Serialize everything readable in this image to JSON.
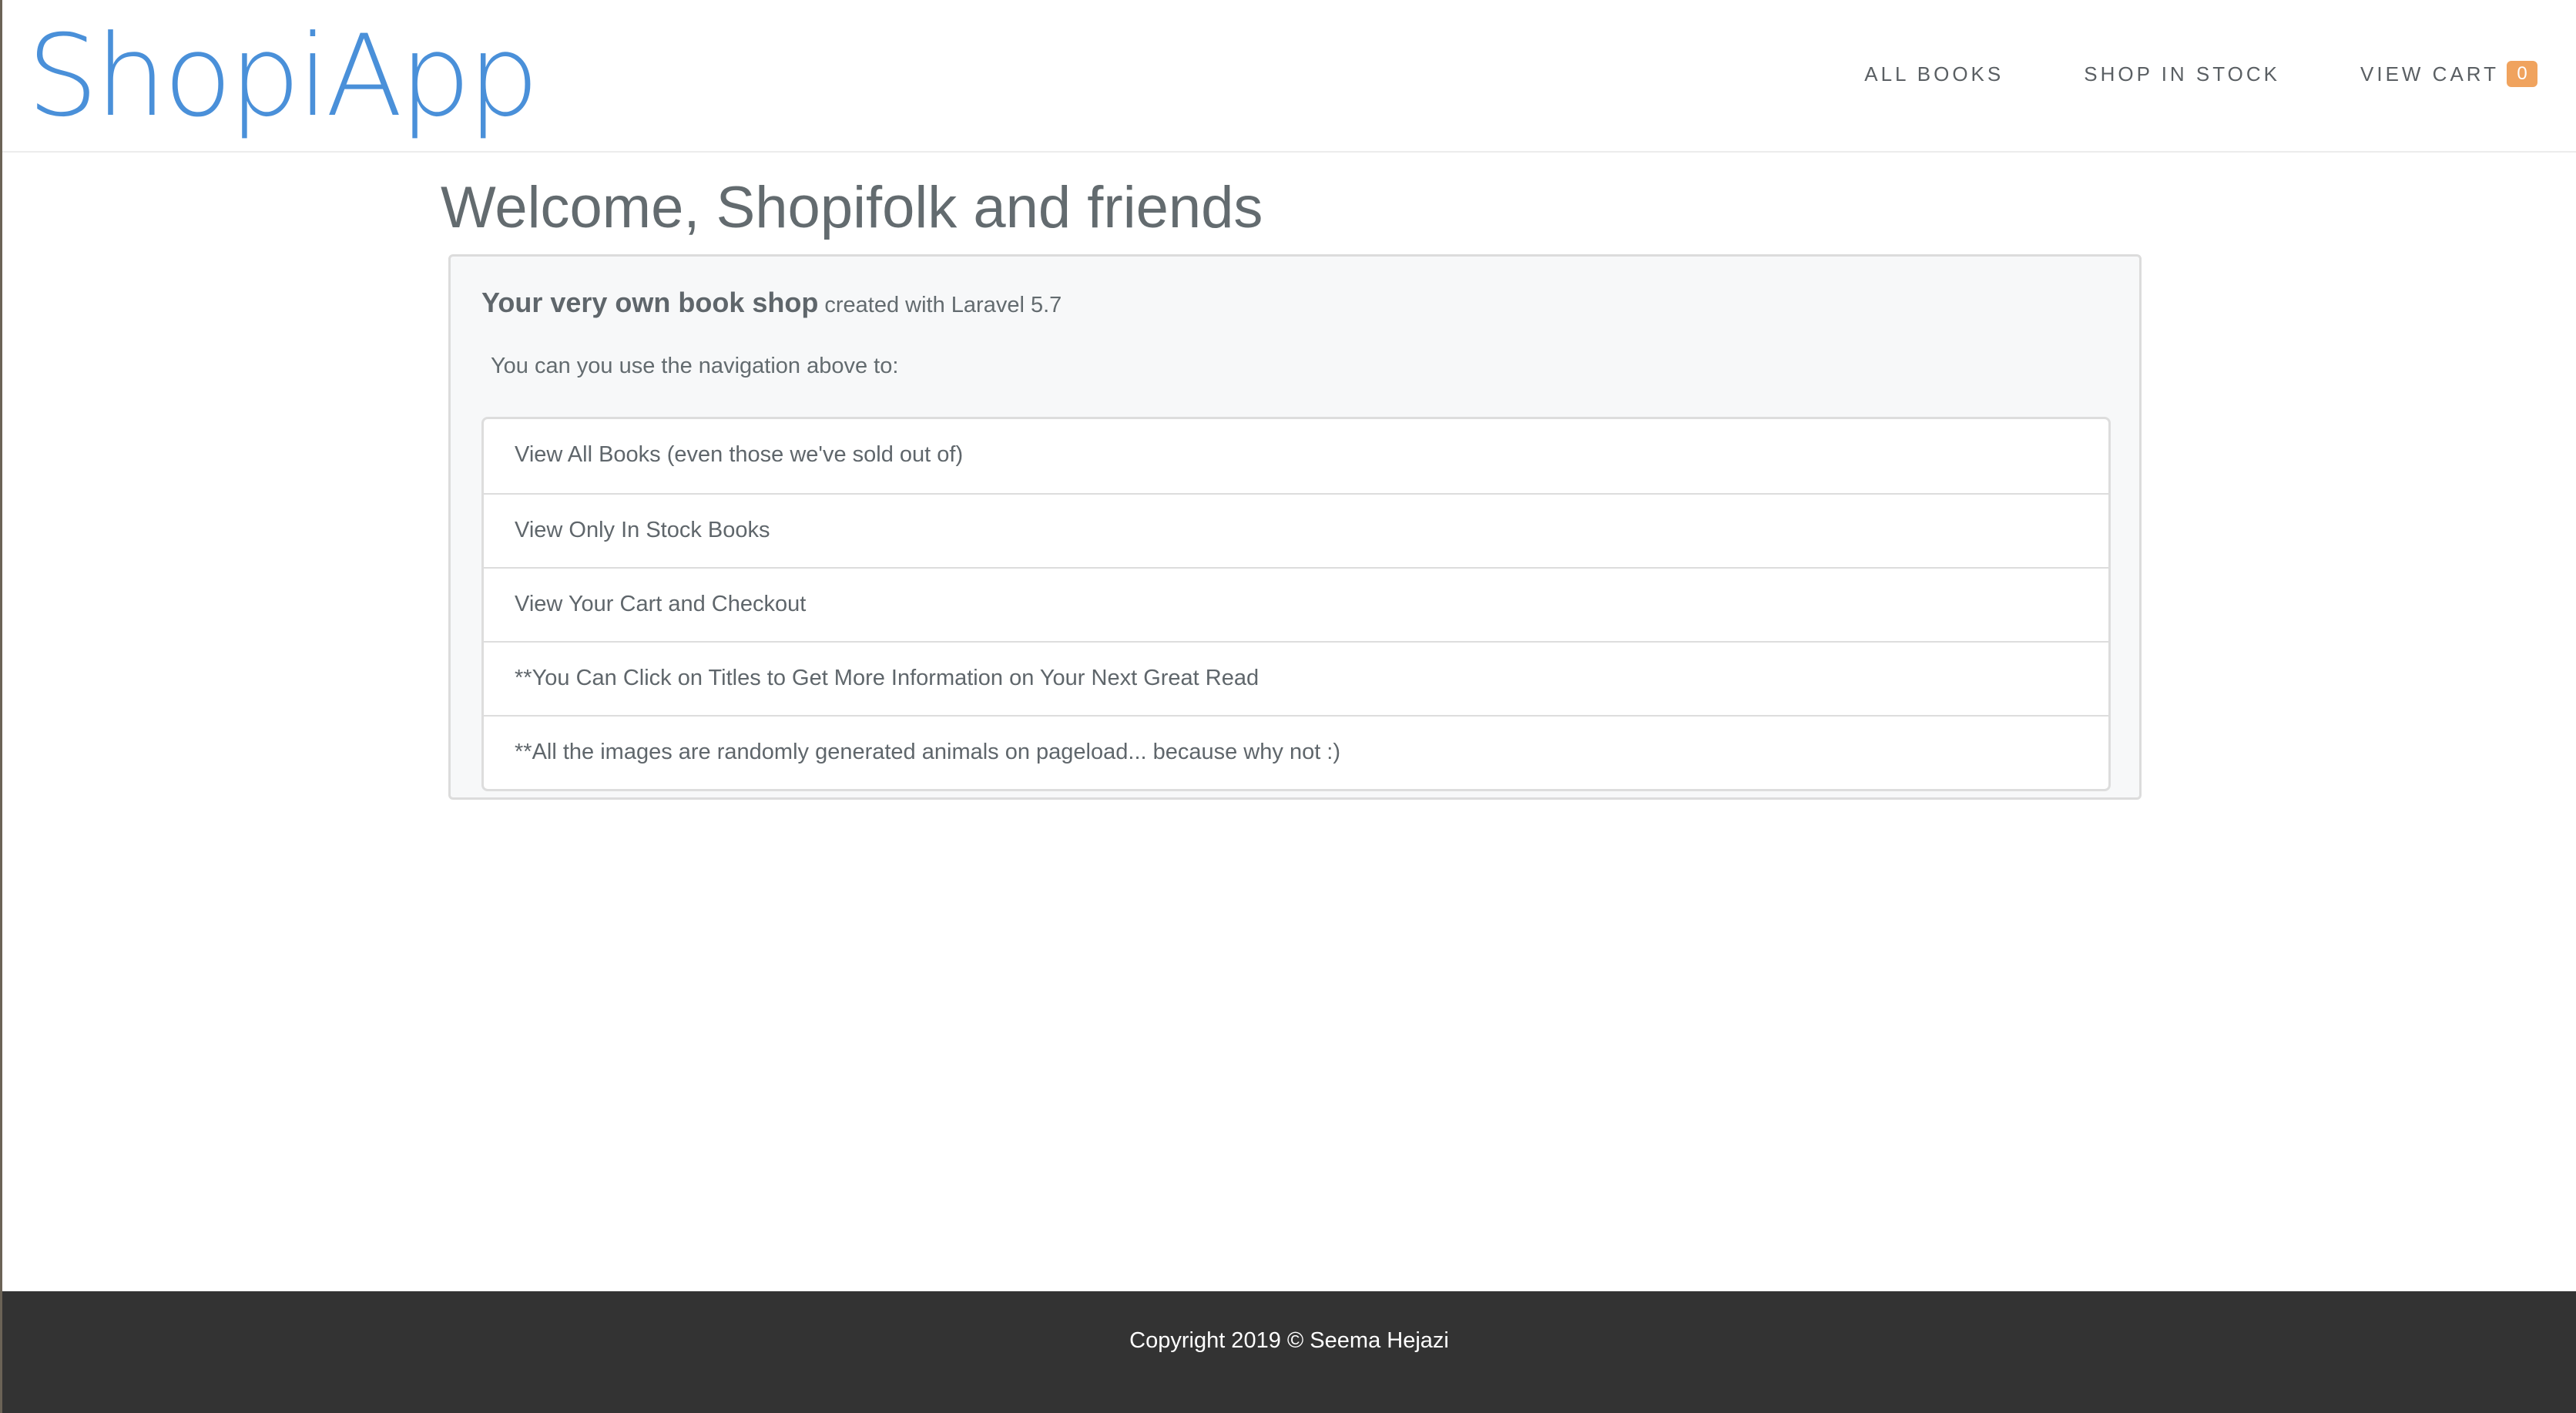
{
  "navbar": {
    "brand": "ShopiApp",
    "links": [
      {
        "label": "ALL BOOKS"
      },
      {
        "label": "SHOP IN STOCK"
      },
      {
        "label": "VIEW CART",
        "badge": "0"
      }
    ]
  },
  "main": {
    "title": "Welcome, Shopifolk and friends",
    "card": {
      "heading": "Your very own book shop",
      "subheading": "created with Laravel 5.7",
      "intro": "You can you use the navigation above to:",
      "items": [
        "View All Books (even those we've sold out of)",
        "View Only In Stock Books",
        "View Your Cart and Checkout",
        "**You Can Click on Titles to Get More Information on Your Next Great Read",
        "**All the images are randomly generated animals on pageload... because why not :)"
      ]
    }
  },
  "footer": {
    "text": "Copyright 2019 © Seema Hejazi"
  },
  "colors": {
    "brand": "#4a90d9",
    "badge": "#f0a35e",
    "footer_bg": "#333333",
    "text": "#636b6f"
  }
}
